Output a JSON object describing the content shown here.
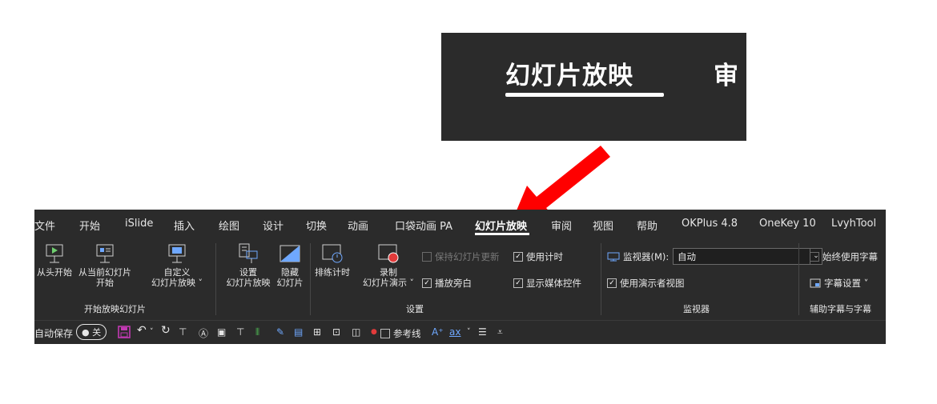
{
  "zoom": {
    "active_tab": "幻灯片放映",
    "next_tab": "审"
  },
  "tabs": [
    "文件",
    "开始",
    "iSlide",
    "插入",
    "绘图",
    "设计",
    "切换",
    "动画",
    "口袋动画 PA",
    "幻灯片放映",
    "审阅",
    "视图",
    "帮助",
    "OKPlus 4.8",
    "OneKey 10",
    "LvyhTool"
  ],
  "groups": {
    "start": {
      "label": "开始放映幻灯片",
      "buttons": [
        {
          "line1": "从头开始",
          "line2": ""
        },
        {
          "line1": "从当前幻灯片",
          "line2": "开始"
        },
        {
          "line1": "自定义",
          "line2": "幻灯片放映 ˅"
        }
      ]
    },
    "setup": {
      "label": "设置",
      "buttons": [
        {
          "line1": "设置",
          "line2": "幻灯片放映"
        },
        {
          "line1": "隐藏",
          "line2": "幻灯片"
        },
        {
          "line1": "排练计时",
          "line2": ""
        },
        {
          "line1": "录制",
          "line2": "幻灯片演示 ˅"
        }
      ],
      "checks": [
        {
          "label": "保持幻灯片更新",
          "checked": false,
          "disabled": true
        },
        {
          "label": "使用计时",
          "checked": true,
          "disabled": false
        },
        {
          "label": "播放旁白",
          "checked": true,
          "disabled": false
        },
        {
          "label": "显示媒体控件",
          "checked": true,
          "disabled": false
        }
      ]
    },
    "monitor": {
      "label": "监视器",
      "monitor_label": "监视器(M):",
      "monitor_value": "自动",
      "presenter_view": "使用演示者视图"
    },
    "subtitles": {
      "label": "辅助字幕与字幕",
      "always_use": "始终使用字幕",
      "settings": "字幕设置 ˅"
    }
  },
  "qat": {
    "autosave": "自动保存",
    "toggle": "关",
    "reference_lines": "参考线"
  },
  "colors": {
    "ribbon_bg": "#2b2b2b",
    "arrow": "#ff0000",
    "save_icon": "#c239b3"
  }
}
